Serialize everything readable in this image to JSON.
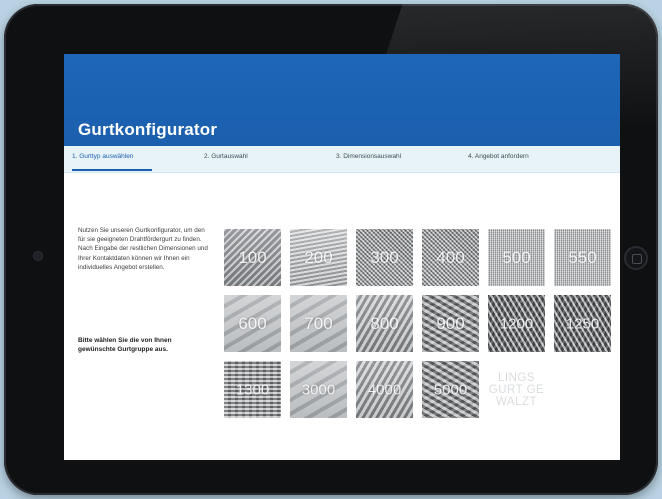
{
  "app": {
    "title": "Gurtkonfigurator"
  },
  "steps": [
    {
      "label": "1. Gurttyp auswählen",
      "active": true
    },
    {
      "label": "2. Gurtauswahl",
      "active": false
    },
    {
      "label": "3. Dimensionsauswahl",
      "active": false
    },
    {
      "label": "4. Angebot anfordern",
      "active": false
    }
  ],
  "intro": {
    "text": "Nutzen Sie unseren Gurtkonfigurator, um den für sie geeigneten Drahtfördergurt zu finden. Nach Eingabe der restlichen Dimensionen und Ihrer Kontaktdaten können wir Ihnen ein individuelles Angebot erstellen.",
    "prompt": "Bitte wählen Sie die von Ihnen gewünschte Gurtgruppe aus."
  },
  "belt_groups": [
    {
      "label": "100",
      "icon": "belt-texture-diagonal"
    },
    {
      "label": "200",
      "icon": "belt-texture-horizontal"
    },
    {
      "label": "300",
      "icon": "belt-texture-mesh"
    },
    {
      "label": "400",
      "icon": "belt-texture-mesh"
    },
    {
      "label": "500",
      "icon": "belt-texture-fine"
    },
    {
      "label": "550",
      "icon": "belt-texture-fine"
    },
    {
      "label": "600",
      "icon": "belt-texture-plate"
    },
    {
      "label": "700",
      "icon": "belt-texture-plate"
    },
    {
      "label": "800",
      "icon": "belt-texture-wave"
    },
    {
      "label": "900",
      "icon": "belt-texture-link"
    },
    {
      "label": "1200",
      "icon": "belt-texture-chain"
    },
    {
      "label": "1250",
      "icon": "belt-texture-chain"
    },
    {
      "label": "1300",
      "icon": "belt-texture-coil"
    },
    {
      "label": "3000",
      "icon": "belt-texture-plate"
    },
    {
      "label": "4000",
      "icon": "belt-texture-wave"
    },
    {
      "label": "5000",
      "icon": "belt-texture-link"
    },
    {
      "label": "LINGS GURT GE WALZT",
      "icon": "text-tile"
    }
  ],
  "colors": {
    "header_blue": "#1b5fae",
    "steps_bar": "#e8f3f8",
    "background": "#b9d3e4"
  }
}
